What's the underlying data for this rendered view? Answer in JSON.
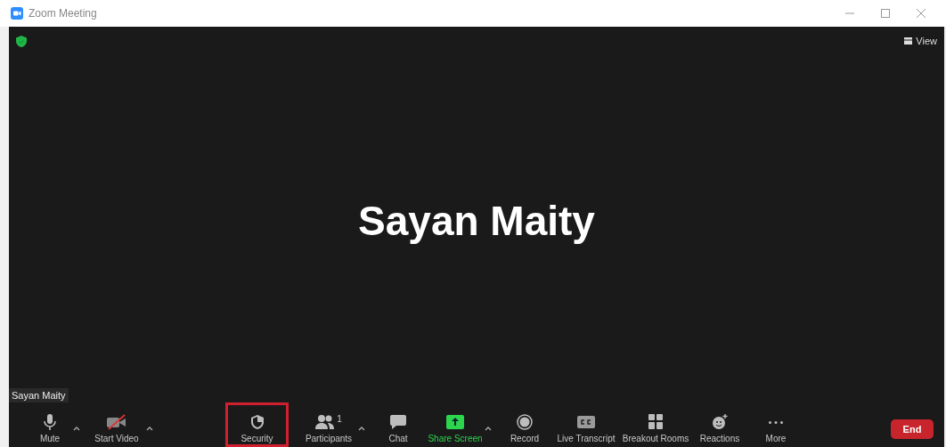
{
  "window": {
    "title": "Zoom Meeting"
  },
  "view_button": {
    "label": "View"
  },
  "participant": {
    "name": "Sayan Maity",
    "name_tag": "Sayan Maity"
  },
  "toolbar": [
    {
      "kind": "mute",
      "label": "Mute",
      "has_menu": true,
      "highlighted": false,
      "accent": false
    },
    {
      "kind": "video",
      "label": "Start Video",
      "has_menu": true,
      "highlighted": false,
      "accent": false
    },
    {
      "kind": "security",
      "label": "Security",
      "has_menu": false,
      "highlighted": true,
      "accent": false
    },
    {
      "kind": "participants",
      "label": "Participants",
      "count": "1",
      "has_menu": true,
      "highlighted": false,
      "accent": false
    },
    {
      "kind": "chat",
      "label": "Chat",
      "has_menu": false,
      "highlighted": false,
      "accent": false
    },
    {
      "kind": "share",
      "label": "Share Screen",
      "has_menu": true,
      "highlighted": false,
      "accent": true
    },
    {
      "kind": "record",
      "label": "Record",
      "has_menu": false,
      "highlighted": false,
      "accent": false
    },
    {
      "kind": "transcript",
      "label": "Live Transcript",
      "has_menu": false,
      "highlighted": false,
      "accent": false
    },
    {
      "kind": "breakout",
      "label": "Breakout Rooms",
      "has_menu": false,
      "highlighted": false,
      "accent": false
    },
    {
      "kind": "reactions",
      "label": "Reactions",
      "has_menu": false,
      "highlighted": false,
      "accent": false
    },
    {
      "kind": "more",
      "label": "More",
      "has_menu": false,
      "highlighted": false,
      "accent": false
    }
  ],
  "end_button": {
    "label": "End"
  }
}
